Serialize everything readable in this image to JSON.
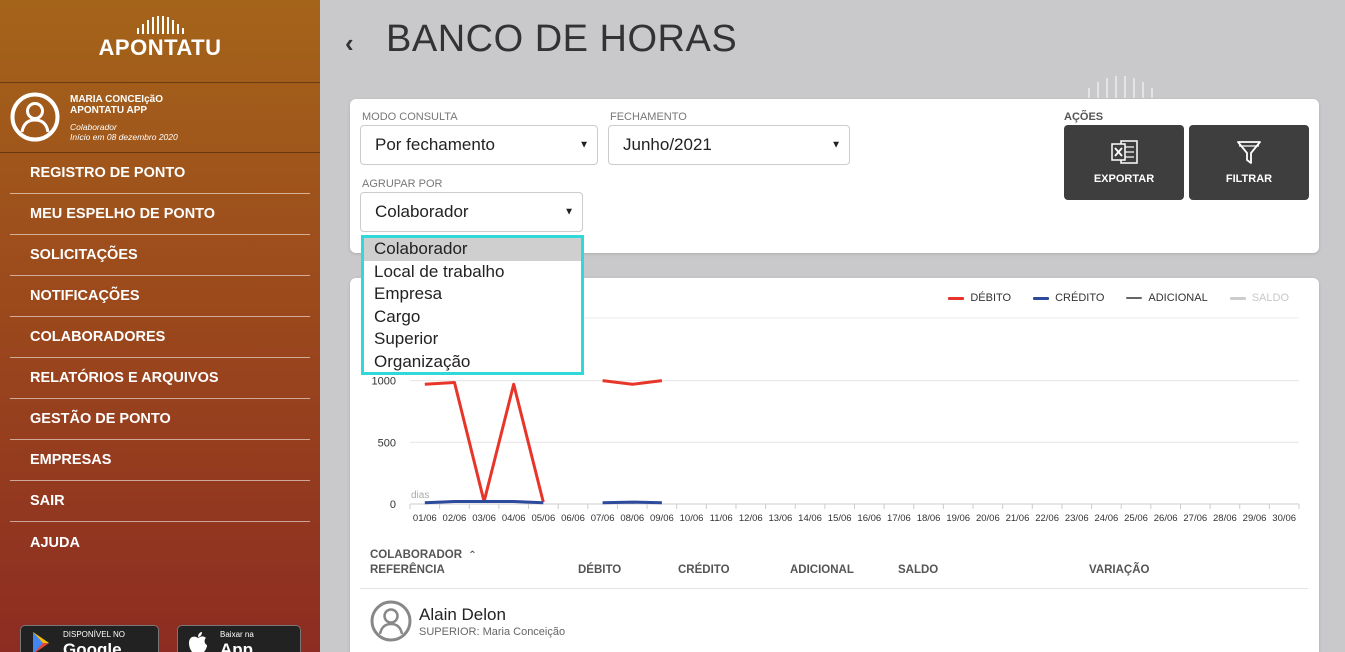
{
  "app": {
    "logo_text": "APONTATU"
  },
  "user": {
    "name_line1": "MARIA CONCEIçãO",
    "name_line2": "APONTATU APP",
    "role": "Colaborador",
    "since": "Início em 08 dezembro 2020"
  },
  "nav": [
    "REGISTRO DE PONTO",
    "MEU ESPELHO DE PONTO",
    "SOLICITAÇÕES",
    "NOTIFICAÇÕES",
    "COLABORADORES",
    "RELATÓRIOS E ARQUIVOS",
    "GESTÃO DE PONTO",
    "EMPRESAS",
    "SAIR",
    "AJUDA"
  ],
  "stores": {
    "google": {
      "small": "DISPONÍVEL NO",
      "big": "Google Play"
    },
    "apple": {
      "small": "Baixar na",
      "big": "App Store"
    }
  },
  "header": {
    "back": "‹",
    "title": "BANCO DE HORAS"
  },
  "filters": {
    "modo_label": "MODO CONSULTA",
    "modo_value": "Por fechamento",
    "fech_label": "FECHAMENTO",
    "fech_value": "Junho/2021",
    "agrupar_label": "AGRUPAR POR",
    "agrupar_value": "Colaborador",
    "acoes_label": "AÇÕES",
    "exportar": "EXPORTAR",
    "filtrar": "FILTRAR"
  },
  "dropdown": {
    "options": [
      "Colaborador",
      "Local de trabalho",
      "Empresa",
      "Cargo",
      "Superior",
      "Organização"
    ],
    "selected": 0
  },
  "legend": {
    "debito": "DÉBITO",
    "credito": "CRÉDITO",
    "adicional": "ADICIONAL",
    "saldo": "SALDO"
  },
  "colors": {
    "debito": "#e8352a",
    "credito": "#2d4a9c",
    "adicional": "#666666",
    "saldo": "#cccccc",
    "focus": "#2fd9d9"
  },
  "chart_data": {
    "type": "line",
    "x": [
      "01/06",
      "02/06",
      "03/06",
      "04/06",
      "05/06",
      "06/06",
      "07/06",
      "08/06",
      "09/06",
      "10/06",
      "11/06",
      "12/06",
      "13/06",
      "14/06",
      "15/06",
      "16/06",
      "17/06",
      "18/06",
      "19/06",
      "20/06",
      "21/06",
      "22/06",
      "23/06",
      "24/06",
      "25/06",
      "26/06",
      "27/06",
      "28/06",
      "29/06",
      "30/06"
    ],
    "yticks": [
      0,
      500,
      1000
    ],
    "ylim": [
      0,
      1500
    ],
    "ylabel": "dias",
    "series": [
      {
        "name": "DÉBITO",
        "values": [
          970,
          985,
          20,
          970,
          15,
          null,
          1000,
          970,
          1000,
          null,
          null,
          null,
          null,
          null,
          null,
          null,
          null,
          null,
          null,
          null,
          null,
          null,
          null,
          null,
          null,
          null,
          null,
          null,
          null,
          null
        ]
      },
      {
        "name": "CRÉDITO",
        "values": [
          10,
          20,
          20,
          20,
          10,
          null,
          10,
          15,
          10,
          null,
          null,
          null,
          null,
          null,
          null,
          null,
          null,
          null,
          null,
          null,
          null,
          null,
          null,
          null,
          null,
          null,
          null,
          null,
          null,
          null
        ]
      }
    ]
  },
  "table": {
    "sort_col": "COLABORADOR",
    "ref": "REFERÊNCIA",
    "debito": "DÉBITO",
    "credito": "CRÉDITO",
    "adicional": "ADICIONAL",
    "saldo": "SALDO",
    "variacao": "VARIAÇÃO",
    "rows": [
      {
        "name": "Alain Delon",
        "superior": "SUPERIOR: Maria Conceição"
      }
    ]
  }
}
